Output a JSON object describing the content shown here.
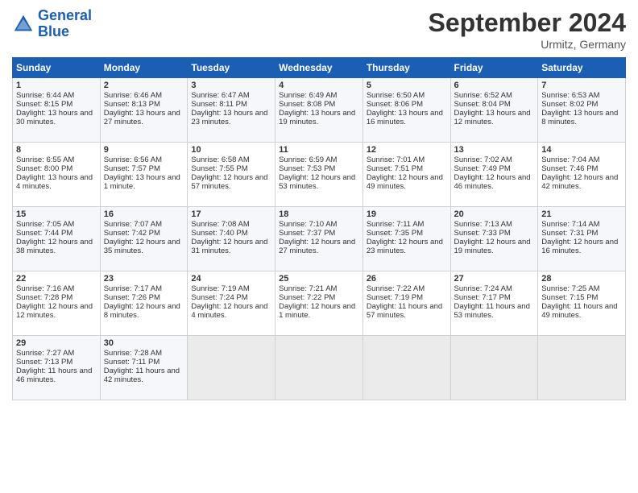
{
  "header": {
    "logo_text_general": "General",
    "logo_text_blue": "Blue",
    "month_year": "September 2024",
    "location": "Urmitz, Germany"
  },
  "days_of_week": [
    "Sunday",
    "Monday",
    "Tuesday",
    "Wednesday",
    "Thursday",
    "Friday",
    "Saturday"
  ],
  "weeks": [
    [
      {
        "day": "1",
        "sunrise": "Sunrise: 6:44 AM",
        "sunset": "Sunset: 8:15 PM",
        "daylight": "Daylight: 13 hours and 30 minutes."
      },
      {
        "day": "2",
        "sunrise": "Sunrise: 6:46 AM",
        "sunset": "Sunset: 8:13 PM",
        "daylight": "Daylight: 13 hours and 27 minutes."
      },
      {
        "day": "3",
        "sunrise": "Sunrise: 6:47 AM",
        "sunset": "Sunset: 8:11 PM",
        "daylight": "Daylight: 13 hours and 23 minutes."
      },
      {
        "day": "4",
        "sunrise": "Sunrise: 6:49 AM",
        "sunset": "Sunset: 8:08 PM",
        "daylight": "Daylight: 13 hours and 19 minutes."
      },
      {
        "day": "5",
        "sunrise": "Sunrise: 6:50 AM",
        "sunset": "Sunset: 8:06 PM",
        "daylight": "Daylight: 13 hours and 16 minutes."
      },
      {
        "day": "6",
        "sunrise": "Sunrise: 6:52 AM",
        "sunset": "Sunset: 8:04 PM",
        "daylight": "Daylight: 13 hours and 12 minutes."
      },
      {
        "day": "7",
        "sunrise": "Sunrise: 6:53 AM",
        "sunset": "Sunset: 8:02 PM",
        "daylight": "Daylight: 13 hours and 8 minutes."
      }
    ],
    [
      {
        "day": "8",
        "sunrise": "Sunrise: 6:55 AM",
        "sunset": "Sunset: 8:00 PM",
        "daylight": "Daylight: 13 hours and 4 minutes."
      },
      {
        "day": "9",
        "sunrise": "Sunrise: 6:56 AM",
        "sunset": "Sunset: 7:57 PM",
        "daylight": "Daylight: 13 hours and 1 minute."
      },
      {
        "day": "10",
        "sunrise": "Sunrise: 6:58 AM",
        "sunset": "Sunset: 7:55 PM",
        "daylight": "Daylight: 12 hours and 57 minutes."
      },
      {
        "day": "11",
        "sunrise": "Sunrise: 6:59 AM",
        "sunset": "Sunset: 7:53 PM",
        "daylight": "Daylight: 12 hours and 53 minutes."
      },
      {
        "day": "12",
        "sunrise": "Sunrise: 7:01 AM",
        "sunset": "Sunset: 7:51 PM",
        "daylight": "Daylight: 12 hours and 49 minutes."
      },
      {
        "day": "13",
        "sunrise": "Sunrise: 7:02 AM",
        "sunset": "Sunset: 7:49 PM",
        "daylight": "Daylight: 12 hours and 46 minutes."
      },
      {
        "day": "14",
        "sunrise": "Sunrise: 7:04 AM",
        "sunset": "Sunset: 7:46 PM",
        "daylight": "Daylight: 12 hours and 42 minutes."
      }
    ],
    [
      {
        "day": "15",
        "sunrise": "Sunrise: 7:05 AM",
        "sunset": "Sunset: 7:44 PM",
        "daylight": "Daylight: 12 hours and 38 minutes."
      },
      {
        "day": "16",
        "sunrise": "Sunrise: 7:07 AM",
        "sunset": "Sunset: 7:42 PM",
        "daylight": "Daylight: 12 hours and 35 minutes."
      },
      {
        "day": "17",
        "sunrise": "Sunrise: 7:08 AM",
        "sunset": "Sunset: 7:40 PM",
        "daylight": "Daylight: 12 hours and 31 minutes."
      },
      {
        "day": "18",
        "sunrise": "Sunrise: 7:10 AM",
        "sunset": "Sunset: 7:37 PM",
        "daylight": "Daylight: 12 hours and 27 minutes."
      },
      {
        "day": "19",
        "sunrise": "Sunrise: 7:11 AM",
        "sunset": "Sunset: 7:35 PM",
        "daylight": "Daylight: 12 hours and 23 minutes."
      },
      {
        "day": "20",
        "sunrise": "Sunrise: 7:13 AM",
        "sunset": "Sunset: 7:33 PM",
        "daylight": "Daylight: 12 hours and 19 minutes."
      },
      {
        "day": "21",
        "sunrise": "Sunrise: 7:14 AM",
        "sunset": "Sunset: 7:31 PM",
        "daylight": "Daylight: 12 hours and 16 minutes."
      }
    ],
    [
      {
        "day": "22",
        "sunrise": "Sunrise: 7:16 AM",
        "sunset": "Sunset: 7:28 PM",
        "daylight": "Daylight: 12 hours and 12 minutes."
      },
      {
        "day": "23",
        "sunrise": "Sunrise: 7:17 AM",
        "sunset": "Sunset: 7:26 PM",
        "daylight": "Daylight: 12 hours and 8 minutes."
      },
      {
        "day": "24",
        "sunrise": "Sunrise: 7:19 AM",
        "sunset": "Sunset: 7:24 PM",
        "daylight": "Daylight: 12 hours and 4 minutes."
      },
      {
        "day": "25",
        "sunrise": "Sunrise: 7:21 AM",
        "sunset": "Sunset: 7:22 PM",
        "daylight": "Daylight: 12 hours and 1 minute."
      },
      {
        "day": "26",
        "sunrise": "Sunrise: 7:22 AM",
        "sunset": "Sunset: 7:19 PM",
        "daylight": "Daylight: 11 hours and 57 minutes."
      },
      {
        "day": "27",
        "sunrise": "Sunrise: 7:24 AM",
        "sunset": "Sunset: 7:17 PM",
        "daylight": "Daylight: 11 hours and 53 minutes."
      },
      {
        "day": "28",
        "sunrise": "Sunrise: 7:25 AM",
        "sunset": "Sunset: 7:15 PM",
        "daylight": "Daylight: 11 hours and 49 minutes."
      }
    ],
    [
      {
        "day": "29",
        "sunrise": "Sunrise: 7:27 AM",
        "sunset": "Sunset: 7:13 PM",
        "daylight": "Daylight: 11 hours and 46 minutes."
      },
      {
        "day": "30",
        "sunrise": "Sunrise: 7:28 AM",
        "sunset": "Sunset: 7:11 PM",
        "daylight": "Daylight: 11 hours and 42 minutes."
      },
      null,
      null,
      null,
      null,
      null
    ]
  ]
}
